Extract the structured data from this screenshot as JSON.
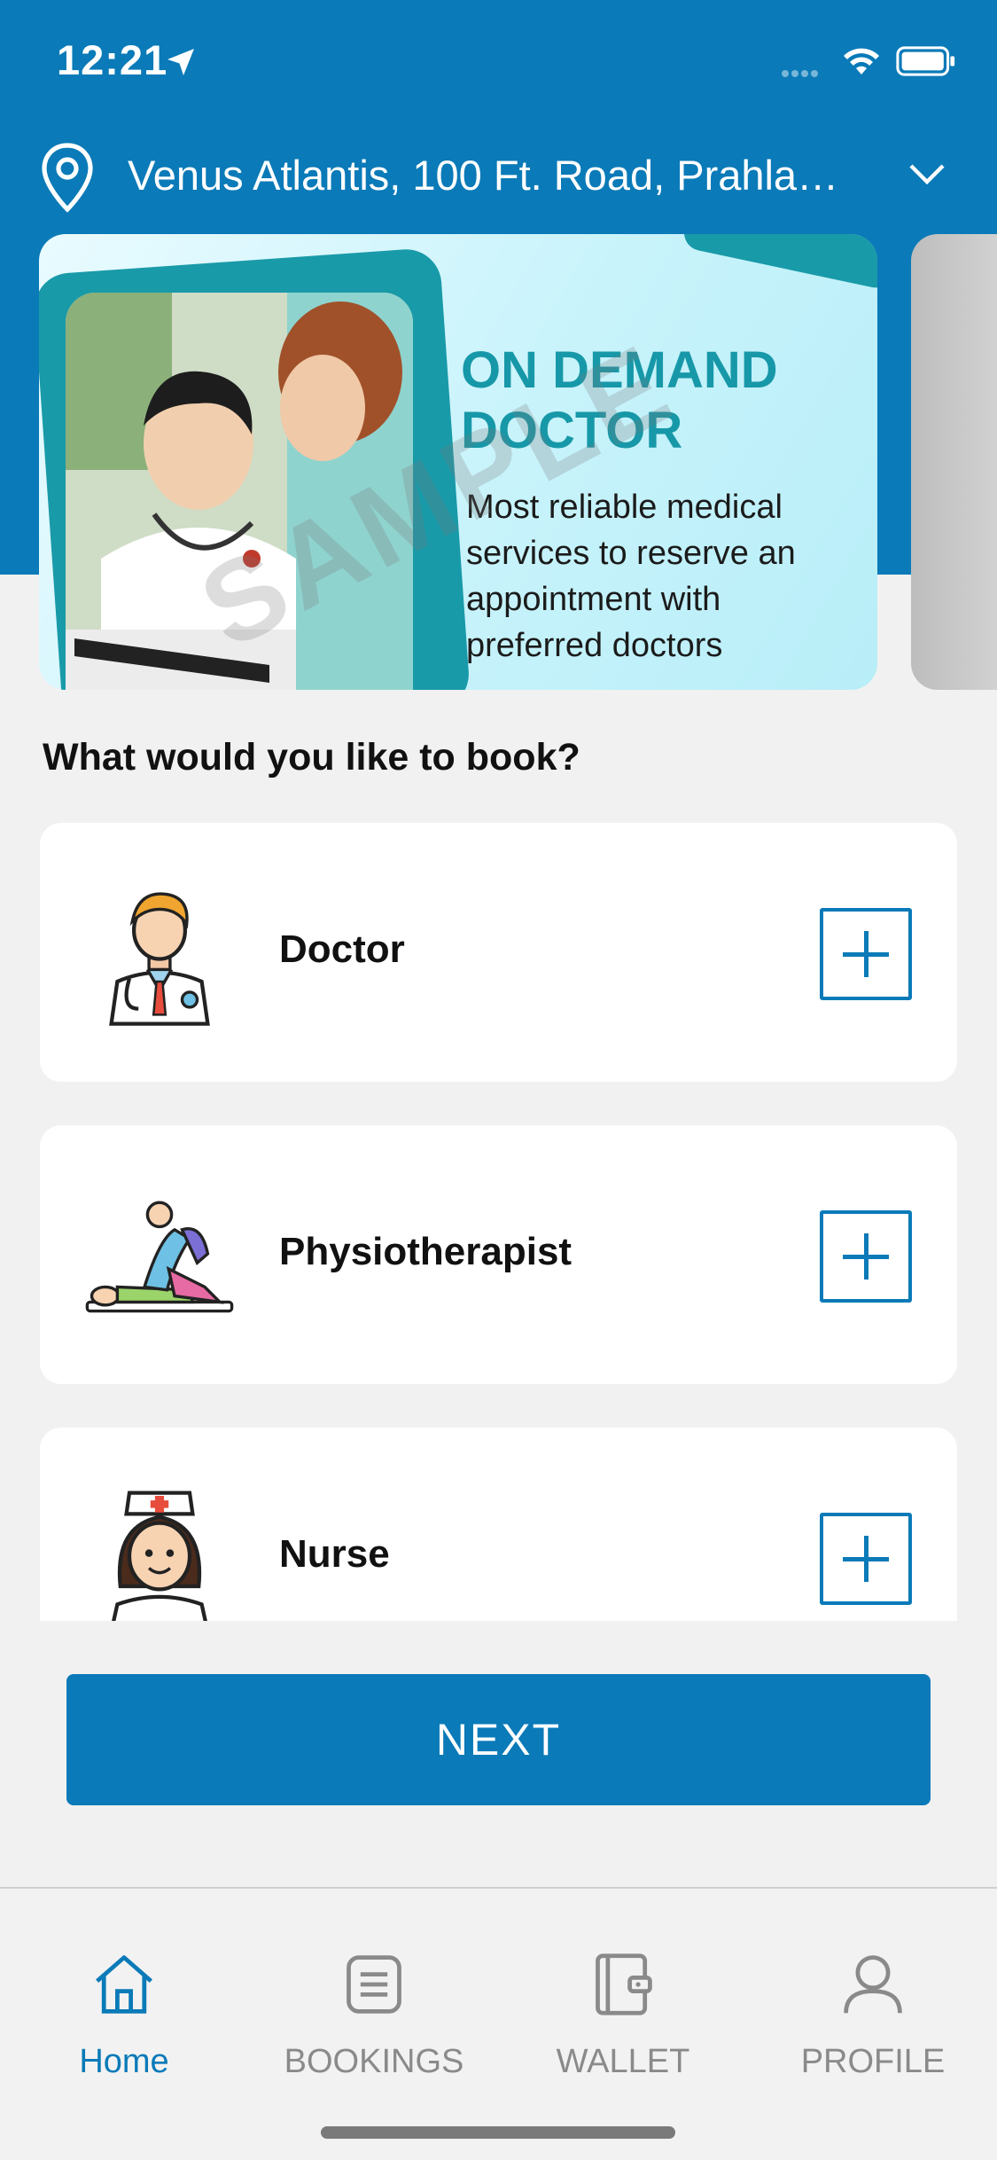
{
  "status_bar": {
    "time": "12:21"
  },
  "location": {
    "address": "Venus Atlantis, 100 Ft. Road, Prahla…"
  },
  "banner": {
    "title": "ON DEMAND DOCTOR",
    "subtitle": "Most reliable medical services to reserve an appointment with preferred doctors",
    "watermark": "SAMPLE"
  },
  "section_title": "What would you like to book?",
  "services": [
    {
      "label": "Doctor",
      "icon": "doctor-icon"
    },
    {
      "label": "Physiotherapist",
      "icon": "physiotherapist-icon"
    },
    {
      "label": "Nurse",
      "icon": "nurse-icon"
    }
  ],
  "next_label": "NEXT",
  "tabs": [
    {
      "label": "Home",
      "icon": "home-icon",
      "active": true
    },
    {
      "label": "BOOKINGS",
      "icon": "bookings-icon",
      "active": false
    },
    {
      "label": "WALLET",
      "icon": "wallet-icon",
      "active": false
    },
    {
      "label": "PROFILE",
      "icon": "profile-icon",
      "active": false
    }
  ],
  "colors": {
    "primary": "#0a7ab8",
    "teal": "#1798a8",
    "background": "#f1f1f1"
  }
}
